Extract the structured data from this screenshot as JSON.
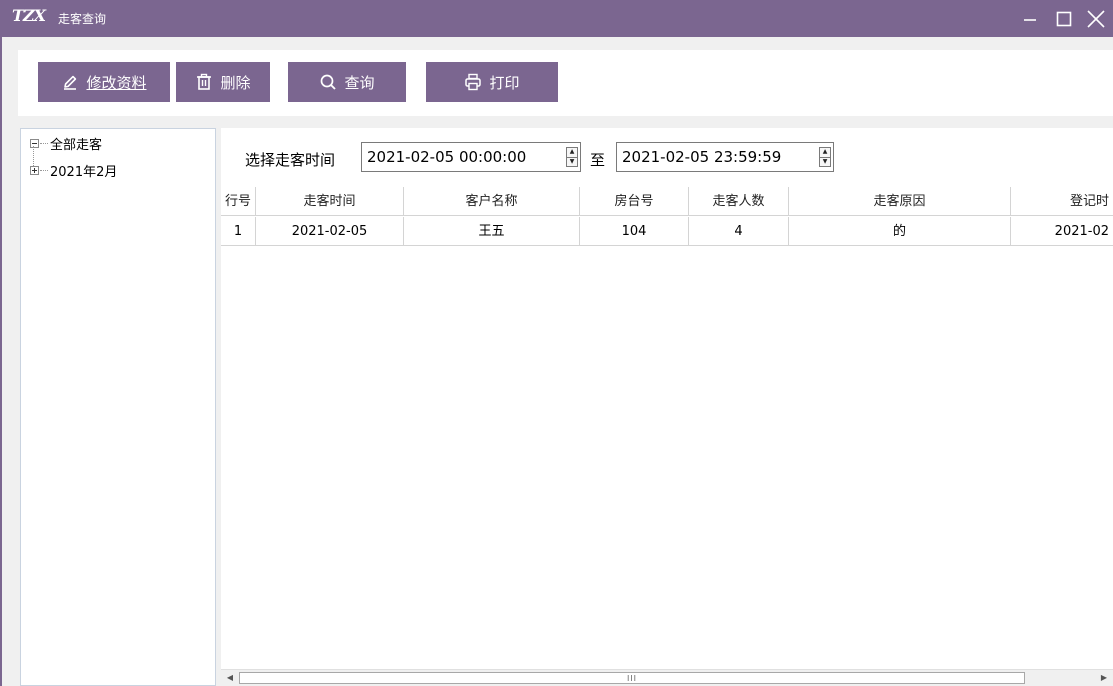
{
  "window": {
    "logo": "TZX",
    "title": "走客查询",
    "controls": {
      "minimize": "—",
      "maximize": "☐",
      "close": "╳"
    }
  },
  "toolbar": {
    "edit": {
      "label": "修改资料",
      "icon": "pencil-icon"
    },
    "delete": {
      "label": "删除",
      "icon": "trash-icon"
    },
    "search": {
      "label": "查询",
      "icon": "search-icon"
    },
    "print": {
      "label": "打印",
      "icon": "printer-icon"
    }
  },
  "tree": {
    "root": "全部走客",
    "children": [
      "2021年2月"
    ]
  },
  "filter": {
    "label": "选择走客时间",
    "from": "2021-02-05 00:00:00",
    "separator": "至",
    "to": "2021-02-05 23:59:59"
  },
  "grid": {
    "columns": [
      "行号",
      "走客时间",
      "客户名称",
      "房台号",
      "走客人数",
      "走客原因",
      "登记时"
    ],
    "rows": [
      [
        "1",
        "2021-02-05",
        "王五",
        "104",
        "4",
        "的",
        "2021-02"
      ]
    ]
  },
  "scrollbar": {
    "grip": "III"
  },
  "colors": {
    "accent": "#7b6690",
    "panel": "#ffffff",
    "background": "#f0f0f0",
    "selected_row": "#e8e8e8",
    "border": "#d4d4d4"
  }
}
